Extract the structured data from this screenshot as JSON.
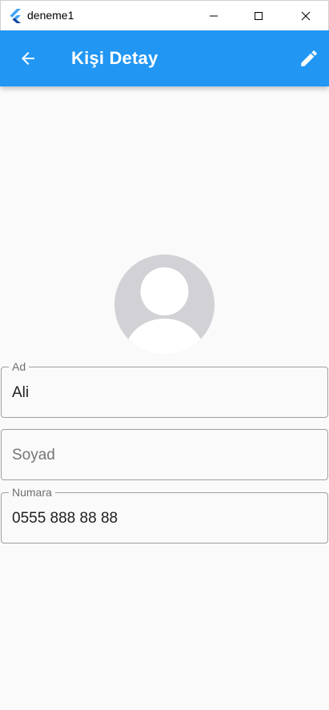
{
  "window": {
    "title": "deneme1",
    "buttons": [
      "minimize",
      "maximize",
      "close"
    ]
  },
  "appbar": {
    "title": "Kişi Detay",
    "back_icon": "arrow-back-icon",
    "edit_icon": "edit-pencil-icon",
    "background": "#2196f3"
  },
  "avatar": {
    "icon": "person-placeholder-icon"
  },
  "form": {
    "ad": {
      "label": "Ad",
      "value": "Ali"
    },
    "soyad": {
      "placeholder": "Soyad",
      "value": ""
    },
    "numara": {
      "label": "Numara",
      "value": "0555 888 88 88"
    }
  }
}
